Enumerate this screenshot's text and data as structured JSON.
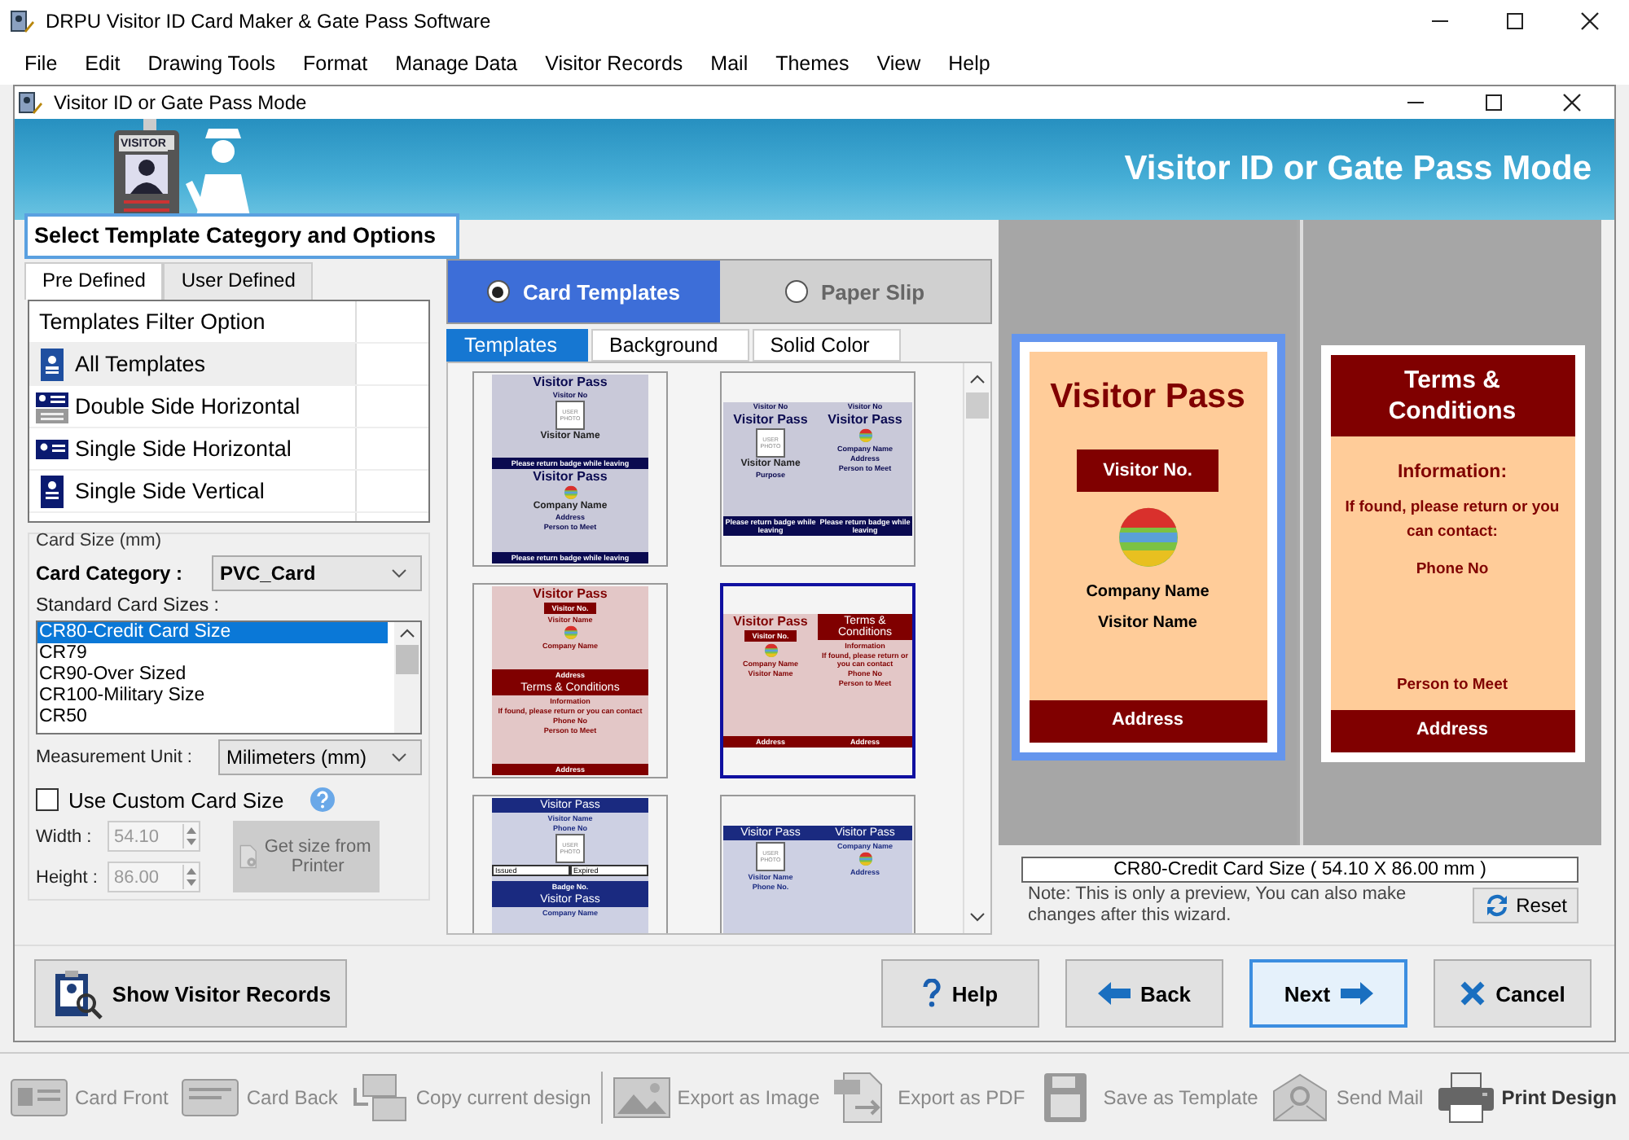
{
  "app_title": "DRPU Visitor ID Card Maker & Gate Pass Software",
  "menu": [
    {
      "label": "File"
    },
    {
      "label": "Edit"
    },
    {
      "label": "Drawing Tools"
    },
    {
      "label": "Format"
    },
    {
      "label": "Manage Data"
    },
    {
      "label": "Visitor Records"
    },
    {
      "label": "Mail"
    },
    {
      "label": "Themes"
    },
    {
      "label": "View"
    },
    {
      "label": "Help"
    }
  ],
  "dialog": {
    "title": "Visitor ID or Gate Pass Mode",
    "banner_title": "Visitor ID or Gate Pass Mode",
    "banner_badge": "VISITOR"
  },
  "section_heading": "Select Template Category and Options",
  "side_tabs": [
    {
      "label": "Pre Defined",
      "selected": true
    },
    {
      "label": "User Defined",
      "selected": false
    }
  ],
  "filter": {
    "header": "Templates Filter Option",
    "items": [
      {
        "label": "All Templates",
        "selected": true,
        "kind": "all"
      },
      {
        "label": "Double Side Horizontal",
        "selected": false,
        "kind": "double"
      },
      {
        "label": "Single Side Horizontal",
        "selected": false,
        "kind": "horizontal"
      },
      {
        "label": "Single Side Vertical",
        "selected": false,
        "kind": "vertical"
      }
    ]
  },
  "card_size": {
    "group_label": "Card Size (mm)",
    "category_label": "Card Category :",
    "category_value": "PVC_Card",
    "sizes_label": "Standard Card Sizes :",
    "sizes": [
      {
        "label": "CR80-Credit Card Size",
        "selected": true
      },
      {
        "label": "CR79",
        "selected": false
      },
      {
        "label": "CR90-Over Sized",
        "selected": false
      },
      {
        "label": "CR100-Military Size",
        "selected": false
      },
      {
        "label": "CR50",
        "selected": false
      }
    ],
    "unit_label": "Measurement Unit :",
    "unit_value": "Milimeters (mm)",
    "custom_label": "Use Custom Card Size",
    "custom_checked": false,
    "width_label": "Width :",
    "width_value": "54.10",
    "height_label": "Height :",
    "height_value": "86.00",
    "printer_button": "Get size from Printer"
  },
  "mode_options": [
    {
      "label": "Card Templates",
      "selected": true
    },
    {
      "label": "Paper Slip",
      "selected": false
    }
  ],
  "template_tabs": [
    {
      "label": "Templates",
      "selected": true
    },
    {
      "label": "Background",
      "selected": false
    },
    {
      "label": "Solid Color",
      "selected": false
    }
  ],
  "templates": [
    {
      "selected": false,
      "kind": "stacked",
      "color": "#0a0a50",
      "panels": [
        [
          {
            "kind": "title",
            "text": "Visitor Pass"
          },
          {
            "kind": "small",
            "text": "Visitor No"
          },
          {
            "kind": "photo",
            "text": "USER PHOTO"
          },
          {
            "kind": "text",
            "text": "Visitor Name"
          },
          {
            "kind": "bar",
            "text": "Please return badge while leaving"
          }
        ],
        [
          {
            "kind": "title",
            "text": "Visitor Pass"
          },
          {
            "kind": "logo"
          },
          {
            "kind": "text",
            "text": "Company Name"
          },
          {
            "kind": "small",
            "text": "Address"
          },
          {
            "kind": "small",
            "text": "Person to Meet"
          },
          {
            "kind": "bar",
            "text": "Please return badge while leaving"
          }
        ]
      ]
    },
    {
      "selected": false,
      "kind": "paired",
      "color": "#0a0a50",
      "panels": [
        [
          {
            "kind": "small",
            "text": "Visitor No"
          },
          {
            "kind": "title",
            "text": "Visitor Pass"
          },
          {
            "kind": "photo",
            "text": "USER PHOTO"
          },
          {
            "kind": "text",
            "text": "Visitor Name"
          },
          {
            "kind": "small",
            "text": "Purpose"
          },
          {
            "kind": "bar",
            "text": "Please return badge while leaving"
          }
        ],
        [
          {
            "kind": "small",
            "text": "Visitor No"
          },
          {
            "kind": "title",
            "text": "Visitor Pass"
          },
          {
            "kind": "logo"
          },
          {
            "kind": "small",
            "text": "Company Name"
          },
          {
            "kind": "small",
            "text": "Address"
          },
          {
            "kind": "small",
            "text": "Person to Meet"
          },
          {
            "kind": "bar",
            "text": "Please return badge while leaving"
          }
        ]
      ]
    },
    {
      "selected": false,
      "kind": "stacked",
      "color": "#800000",
      "panels": [
        [
          {
            "kind": "title",
            "text": "Visitor Pass"
          },
          {
            "kind": "badge",
            "text": "Visitor No."
          },
          {
            "kind": "small",
            "text": "Visitor Name"
          },
          {
            "kind": "logo"
          },
          {
            "kind": "small",
            "text": "Company Name"
          },
          {
            "kind": "bar",
            "text": "Address"
          }
        ],
        [
          {
            "kind": "header",
            "text": "Terms & Conditions"
          },
          {
            "kind": "small",
            "text": "Information"
          },
          {
            "kind": "small",
            "text": "If found, please return or you can contact"
          },
          {
            "kind": "small",
            "text": "Phone No"
          },
          {
            "kind": "small",
            "text": "Person to Meet"
          },
          {
            "kind": "bar",
            "text": "Address"
          }
        ]
      ]
    },
    {
      "selected": true,
      "kind": "paired",
      "color": "#800000",
      "panels": [
        [
          {
            "kind": "title",
            "text": "Visitor Pass"
          },
          {
            "kind": "badge",
            "text": "Visitor No."
          },
          {
            "kind": "logo"
          },
          {
            "kind": "small",
            "text": "Company Name"
          },
          {
            "kind": "small",
            "text": "Visitor Name"
          },
          {
            "kind": "bar",
            "text": "Address"
          }
        ],
        [
          {
            "kind": "header",
            "text": "Terms & Conditions"
          },
          {
            "kind": "small",
            "text": "Information"
          },
          {
            "kind": "small",
            "text": "If found, please return or you can contact"
          },
          {
            "kind": "small",
            "text": "Phone No"
          },
          {
            "kind": "small",
            "text": "Person to Meet"
          },
          {
            "kind": "bar",
            "text": "Address"
          }
        ]
      ]
    },
    {
      "selected": false,
      "kind": "stacked",
      "color": "#1a2a80",
      "panels": [
        [
          {
            "kind": "header",
            "text": "Visitor Pass"
          },
          {
            "kind": "small",
            "text": "Visitor Name"
          },
          {
            "kind": "small",
            "text": "Phone No"
          },
          {
            "kind": "photo",
            "text": "USER PHOTO"
          },
          {
            "kind": "cells",
            "texts": [
              "Issued",
              "Expired"
            ]
          },
          {
            "kind": "bar",
            "text": "Badge No."
          }
        ],
        [
          {
            "kind": "header",
            "text": "Visitor Pass"
          },
          {
            "kind": "small",
            "text": "Company Name"
          }
        ]
      ]
    },
    {
      "selected": false,
      "kind": "paired",
      "color": "#1a2a80",
      "panels": [
        [
          {
            "kind": "header",
            "text": "Visitor Pass"
          },
          {
            "kind": "photo",
            "text": "USER PHOTO"
          },
          {
            "kind": "small",
            "text": "Visitor Name"
          },
          {
            "kind": "small",
            "text": "Phone No."
          }
        ],
        [
          {
            "kind": "header",
            "text": "Visitor Pass"
          },
          {
            "kind": "small",
            "text": "Company Name"
          },
          {
            "kind": "logo"
          },
          {
            "kind": "small",
            "text": "Address"
          }
        ]
      ]
    }
  ],
  "preview": {
    "front": {
      "selected": true,
      "title": "Visitor Pass",
      "badge": "Visitor No.",
      "company": "Company Name",
      "visitor": "Visitor Name",
      "footer": "Address"
    },
    "back": {
      "selected": false,
      "header": "Terms & Conditions",
      "info": "Information:",
      "note": "If found, please return or you can contact:",
      "phone": "Phone No",
      "person": "Person to Meet",
      "footer": "Address"
    },
    "size_caption": "CR80-Credit Card Size ( 54.10 X 86.00 mm )",
    "note": "Note: This is only a preview, You can also make changes after this wizard.",
    "reset": "Reset"
  },
  "buttons": [
    {
      "label": "Show Visitor Records",
      "kind": "records",
      "default": false
    },
    {
      "label": "Help",
      "kind": "help",
      "default": false
    },
    {
      "label": "Back",
      "kind": "back",
      "default": false
    },
    {
      "label": "Next",
      "kind": "next",
      "default": true
    },
    {
      "label": "Cancel",
      "kind": "cancel",
      "default": false
    }
  ],
  "toolbar": [
    {
      "label": "Card Front",
      "kind": "front",
      "disabled": true
    },
    {
      "label": "Card Back",
      "kind": "back",
      "disabled": true
    },
    {
      "label": "Copy current design",
      "kind": "copy",
      "disabled": true
    },
    {
      "label": "Export as Image",
      "kind": "image",
      "disabled": true
    },
    {
      "label": "Export as PDF",
      "kind": "pdf",
      "disabled": true
    },
    {
      "label": "Save as Template",
      "kind": "save",
      "disabled": true
    },
    {
      "label": "Send Mail",
      "kind": "mail",
      "disabled": true
    },
    {
      "label": "Print Design",
      "kind": "print",
      "disabled": false
    }
  ]
}
